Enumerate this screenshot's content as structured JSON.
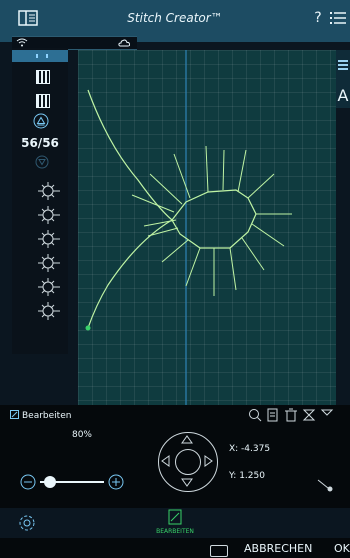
{
  "header": {
    "title": "Stitch Creator™",
    "help": "?",
    "menu_icon": "menu-icon",
    "left_icon": "panel-toggle-icon"
  },
  "status": {
    "wifi_icon": "wifi-icon",
    "cloud_icon": "cloud-icon"
  },
  "left_panel": {
    "counter": "56/56",
    "up_icon": "up-arrow-icon",
    "down_icon": "down-arrow-icon"
  },
  "canvas": {
    "grid": true
  },
  "right_panel": {
    "partial_letter": "A"
  },
  "toolbar": {
    "edit_label": "Bearbeiten",
    "tools": [
      "zoom-icon",
      "document-icon",
      "trash-icon",
      "mirror-icon",
      "duplicate-icon"
    ]
  },
  "zoom": {
    "label": "80%",
    "level": 0.05
  },
  "position": {
    "x_label": "X: -4.375",
    "y_label": "Y: 1.250"
  },
  "edit_tab": {
    "label": "BEARBEITEN"
  },
  "footer": {
    "cancel": "ABBRECHEN",
    "ok": "OK"
  },
  "colors": {
    "accent": "#2d6f94",
    "header": "#1d4c63",
    "canvas": "#0f3b3f",
    "active": "#39d269"
  }
}
